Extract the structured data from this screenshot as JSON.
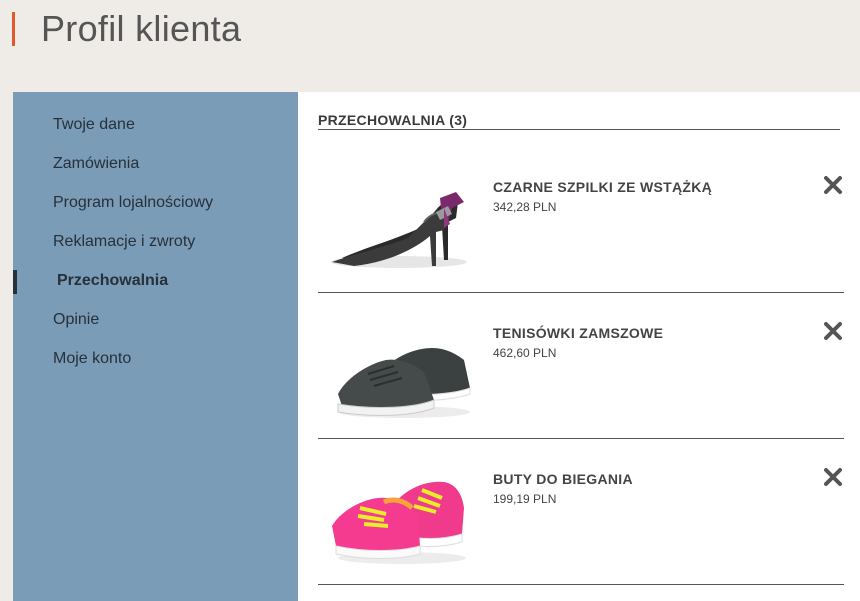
{
  "header": {
    "title": "Profil klienta"
  },
  "sidebar": {
    "items": [
      {
        "label": "Twoje dane"
      },
      {
        "label": "Zamówienia"
      },
      {
        "label": "Program lojalnościowy"
      },
      {
        "label": "Reklamacje i zwroty"
      },
      {
        "label": "Przechowalnia",
        "active": true
      },
      {
        "label": "Opinie"
      },
      {
        "label": "Moje konto"
      }
    ]
  },
  "main": {
    "section_title": "PRZECHOWALNIA (3)",
    "items": [
      {
        "name": "CZARNE SZPILKI ZE WSTĄŻKĄ",
        "price": "342,28 PLN",
        "image_icon": "black-heels-image",
        "remove_icon": "close-icon"
      },
      {
        "name": "TENISÓWKI ZAMSZOWE",
        "price": "462,60 PLN",
        "image_icon": "suede-sneakers-image",
        "remove_icon": "close-icon"
      },
      {
        "name": "BUTY DO BIEGANIA",
        "price": "199,19 PLN",
        "image_icon": "running-shoes-image",
        "remove_icon": "close-icon"
      }
    ]
  },
  "colors": {
    "accent": "#e25a2c",
    "sidebar_bg": "#7a9cb7",
    "header_bg": "#efebe6"
  }
}
